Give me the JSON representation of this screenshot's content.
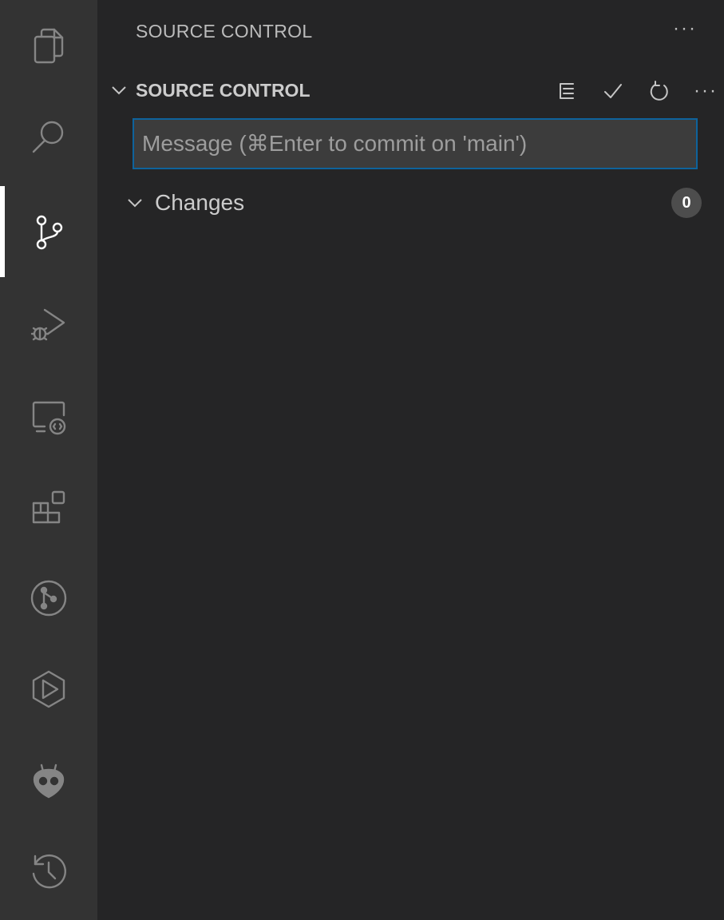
{
  "activity_bar": {
    "items": [
      {
        "icon": "explorer-icon"
      },
      {
        "icon": "search-icon"
      },
      {
        "icon": "source-control-icon",
        "active": true
      },
      {
        "icon": "run-debug-icon"
      },
      {
        "icon": "remote-explorer-icon"
      },
      {
        "icon": "extensions-icon"
      },
      {
        "icon": "git-graph-icon"
      },
      {
        "icon": "live-share-icon"
      },
      {
        "icon": "platformio-icon"
      },
      {
        "icon": "timeline-icon"
      }
    ]
  },
  "sidebar": {
    "title": "SOURCE CONTROL",
    "more": "···"
  },
  "section": {
    "title": "SOURCE CONTROL",
    "actions": {
      "view_as_tree_icon": "list-tree-icon",
      "commit_icon": "check-icon",
      "refresh_icon": "refresh-icon",
      "more": "···"
    }
  },
  "commit": {
    "placeholder": "Message (⌘Enter to commit on 'main')",
    "value": ""
  },
  "changes": {
    "label": "Changes",
    "count": "0"
  },
  "colors": {
    "activity_bar_bg": "#333333",
    "sidebar_bg": "#252526",
    "input_border": "#0e639c",
    "badge_bg": "#4d4d4d"
  }
}
